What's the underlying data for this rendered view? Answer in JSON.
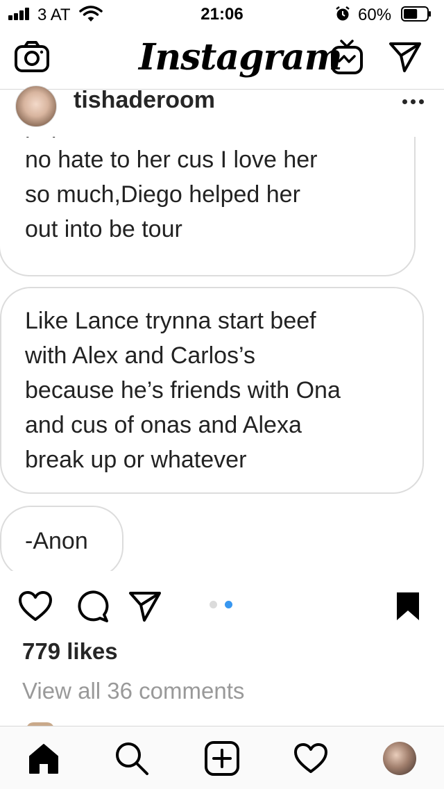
{
  "status_bar": {
    "carrier": "3 AT",
    "time": "21:06",
    "battery_percent": "60%",
    "battery_level": 0.6,
    "icons": [
      "signal-icon",
      "wifi-icon",
      "alarm-icon",
      "battery-icon"
    ]
  },
  "nav": {
    "logo": "Instagram",
    "icons": [
      "camera-icon",
      "igtv-icon",
      "direct-send-icon"
    ]
  },
  "post": {
    "username": "tishaderoom",
    "more_icon": "more-dots-icon",
    "bubbles": [
      {
        "text": "popular like Desiree,like I said\nno hate to her cus I love her\nso much,Diego helped her\nout into be tour"
      },
      {
        "text": "Like Lance trynna start beef\nwith Alex and Carlos’s\nbecause he’s friends with Ona\nand cus of onas and Alexa\nbreak up or whatever"
      },
      {
        "text": "-Anon"
      }
    ],
    "carousel": {
      "total": 2,
      "active": 2,
      "active_color": "#3897f0",
      "inactive_color": "#dbdbdb"
    },
    "actions": [
      "heart-icon",
      "comment-icon",
      "share-icon",
      "bookmark-icon"
    ],
    "likes": "779 likes",
    "comments_link": "View all 36 comments"
  },
  "tab_bar": {
    "items": [
      "home-icon",
      "search-icon",
      "add-post-icon",
      "activity-heart-icon",
      "profile-avatar"
    ]
  }
}
